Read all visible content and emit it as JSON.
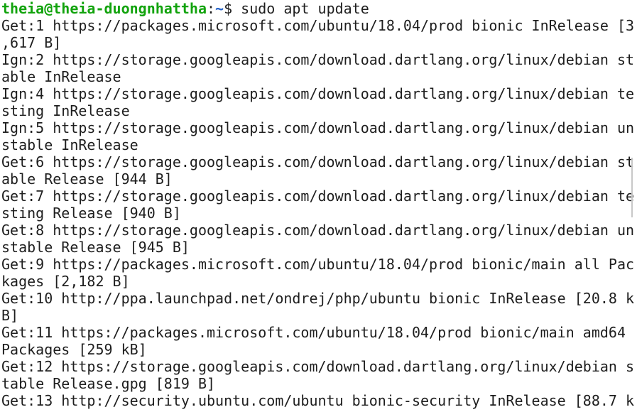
{
  "prompt": {
    "user_host": "theia@theia-duongnhattha",
    "separator": ":",
    "path": "~",
    "symbol": "$",
    "command": " sudo apt update"
  },
  "lines": [
    "Get:1 https://packages.microsoft.com/ubuntu/18.04/prod bionic InRelease [3",
    ",617 B]",
    "Ign:2 https://storage.googleapis.com/download.dartlang.org/linux/debian st",
    "able InRelease",
    "Ign:4 https://storage.googleapis.com/download.dartlang.org/linux/debian te",
    "sting InRelease",
    "Ign:5 https://storage.googleapis.com/download.dartlang.org/linux/debian un",
    "stable InRelease",
    "Get:6 https://storage.googleapis.com/download.dartlang.org/linux/debian st",
    "able Release [944 B]",
    "Get:7 https://storage.googleapis.com/download.dartlang.org/linux/debian te",
    "sting Release [940 B]",
    "Get:8 https://storage.googleapis.com/download.dartlang.org/linux/debian un",
    "stable Release [945 B]",
    "Get:9 https://packages.microsoft.com/ubuntu/18.04/prod bionic/main all Pac",
    "kages [2,182 B]",
    "Get:10 http://ppa.launchpad.net/ondrej/php/ubuntu bionic InRelease [20.8 k",
    "B]",
    "Get:11 https://packages.microsoft.com/ubuntu/18.04/prod bionic/main amd64",
    "Packages [259 kB]",
    "Get:12 https://storage.googleapis.com/download.dartlang.org/linux/debian s",
    "table Release.gpg [819 B]",
    "Get:13 http://security.ubuntu.com/ubuntu bionic-security InRelease [88.7 k"
  ]
}
